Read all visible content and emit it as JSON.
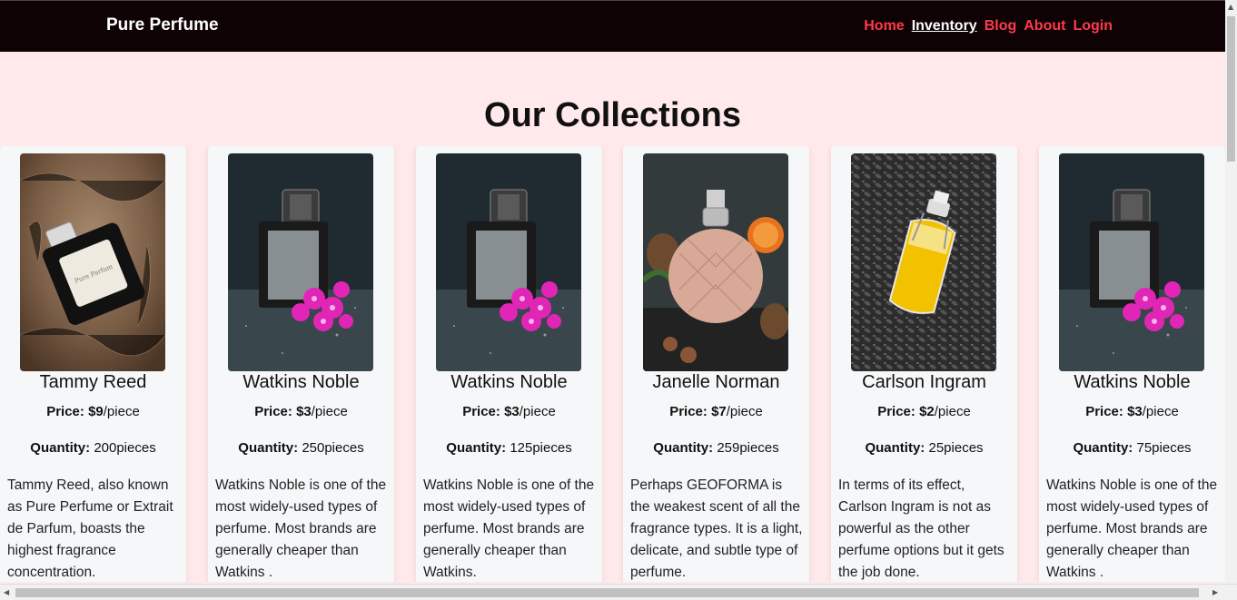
{
  "nav": {
    "brand": "Pure Perfume",
    "links": [
      "Home",
      "Inventory",
      "Blog",
      "About",
      "Login"
    ]
  },
  "page_title": "Our Collections",
  "labels": {
    "price": "Price:",
    "quantity": "Quantity:",
    "price_unit": "/piece",
    "qty_unit": "pieces"
  },
  "products": [
    {
      "name": "Tammy Reed",
      "price": "$9",
      "quantity": "200",
      "description": "Tammy Reed, also known as Pure Perfume or Extrait de Parfum, boasts the highest fragrance concentration.",
      "image": "perfume-on-fur-image"
    },
    {
      "name": "Watkins Noble",
      "price": "$3",
      "quantity": "250",
      "description": "Watkins Noble is one of the most widely-used types of perfume. Most brands are generally cheaper than Watkins .",
      "image": "perfume-with-flowers-image"
    },
    {
      "name": "Watkins Noble",
      "price": "$3",
      "quantity": "125",
      "description": "Watkins Noble is one of the most widely-used types of perfume. Most brands are generally cheaper than Watkins.",
      "image": "perfume-with-flowers-image"
    },
    {
      "name": "Janelle Norman",
      "price": "$7",
      "quantity": "259",
      "description": "Perhaps GEOFORMA is the weakest scent of all the fragrance types. It is a light, delicate, and subtle type of perfume.",
      "image": "crystal-perfume-bottle-image"
    },
    {
      "name": "Carlson Ingram",
      "price": "$2",
      "quantity": "25",
      "description": "In terms of its effect, Carlson Ingram is not as powerful as the other perfume options but it gets the job done.",
      "image": "oil-bottle-on-seeds-image"
    },
    {
      "name": "Watkins Noble",
      "price": "$3",
      "quantity": "75",
      "description": "Watkins Noble is one of the most widely-used types of perfume. Most brands are generally cheaper than Watkins .",
      "image": "perfume-with-flowers-image"
    }
  ],
  "colors": {
    "nav_bg": "#0f0204",
    "nav_link": "#ff3a4d",
    "page_bg": "#ffe9ea",
    "card_bg": "#f6f7f9"
  }
}
